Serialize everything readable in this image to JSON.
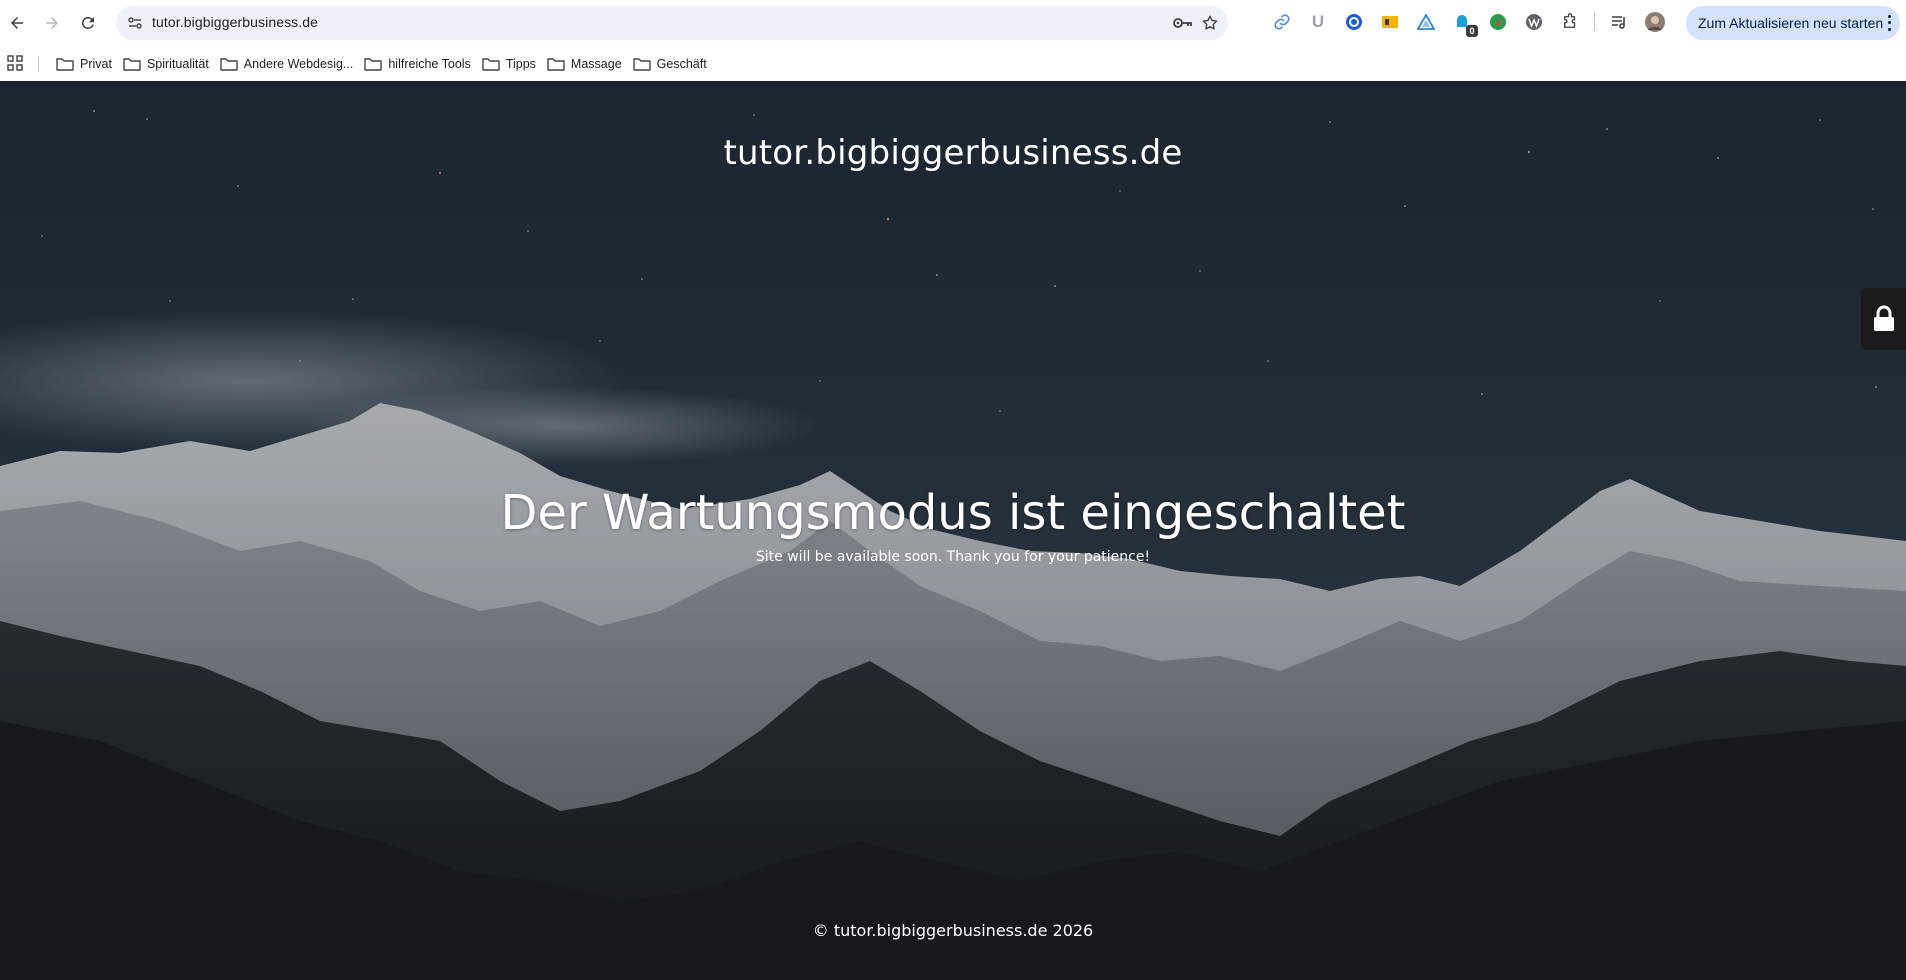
{
  "browser": {
    "address_bar": {
      "url": "tutor.bigbiggerbusiness.de"
    },
    "extensions": [
      {
        "name": "link-extension-icon"
      },
      {
        "name": "u-extension-icon",
        "label": "U"
      },
      {
        "name": "blue-circle-extension-icon"
      },
      {
        "name": "yellow-box-extension-icon"
      },
      {
        "name": "triangle-extension-icon"
      },
      {
        "name": "badge-extension-icon",
        "badge": "0"
      },
      {
        "name": "green-leaf-extension-icon"
      },
      {
        "name": "wordpress-extension-icon"
      },
      {
        "name": "puzzle-icon"
      }
    ],
    "update_button_label": "Zum Aktualisieren neu starten"
  },
  "bookmarks": [
    {
      "label": "Privat"
    },
    {
      "label": "Spiritualität"
    },
    {
      "label": "Andere Webdesig..."
    },
    {
      "label": "hilfreiche Tools"
    },
    {
      "label": "Tipps"
    },
    {
      "label": "Massage"
    },
    {
      "label": "Geschäft"
    }
  ],
  "page": {
    "site_title": "tutor.bigbiggerbusiness.de",
    "headline": "Der Wartungsmodus ist eingeschaltet",
    "subline": "Site will be available soon. Thank you for your patience!",
    "footer": "© tutor.bigbiggerbusiness.de 2026"
  },
  "colors": {
    "update_button_bg": "#d3e3fd",
    "omnibox_bg": "#eef1f7",
    "sky_top": "#1f2a38",
    "lock_tab_bg": "#1a1a1a"
  }
}
